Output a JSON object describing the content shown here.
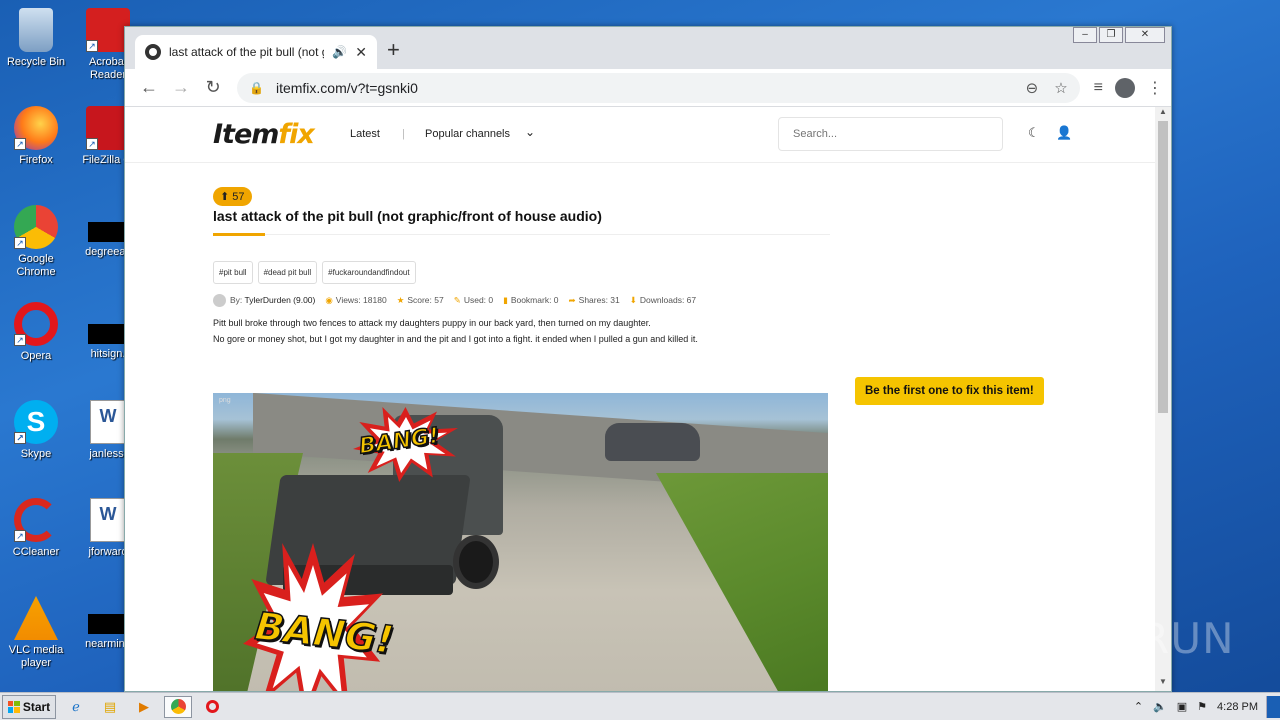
{
  "desktop": {
    "icons": [
      {
        "label": "Recycle Bin",
        "icon": "recycle-bin-icon",
        "color": "#9ab8d8"
      },
      {
        "label": "Acrobat Reader",
        "icon": "acrobat-icon",
        "color": "#d41f1f"
      },
      {
        "label": "Firefox",
        "icon": "firefox-icon",
        "color": "#ff7a18"
      },
      {
        "label": "FileZilla Cl",
        "icon": "filezilla-icon",
        "color": "#c7161d"
      },
      {
        "label": "Google Chrome",
        "icon": "chrome-icon",
        "color": "#34a853"
      },
      {
        "label": "degreeac",
        "icon": "file-icon",
        "color": "#000000"
      },
      {
        "label": "Opera",
        "icon": "opera-icon",
        "color": "#e2171c"
      },
      {
        "label": "hitsign.",
        "icon": "file-icon",
        "color": "#000000"
      },
      {
        "label": "Skype",
        "icon": "skype-icon",
        "color": "#00aff0"
      },
      {
        "label": "janless.",
        "icon": "word-icon",
        "color": "#2b5797"
      },
      {
        "label": "CCleaner",
        "icon": "ccleaner-icon",
        "color": "#d9281e"
      },
      {
        "label": "jforward",
        "icon": "word-icon",
        "color": "#2b5797"
      },
      {
        "label": "VLC media player",
        "icon": "vlc-icon",
        "color": "#f28c00"
      },
      {
        "label": "nearminu",
        "icon": "file-icon",
        "color": "#000000"
      }
    ]
  },
  "browser": {
    "tab_title": "last attack of the pit bull (not gr",
    "new_tab": "+",
    "url": "itemfix.com/v?t=gsnki0"
  },
  "site": {
    "logo_main": "Item",
    "logo_accent": "fix",
    "nav_latest": "Latest",
    "nav_sep": "|",
    "nav_popular": "Popular channels",
    "search_placeholder": "Search..."
  },
  "item": {
    "score_badge": "57",
    "title": "last attack of the pit bull (not graphic/front of house audio)",
    "tags": [
      "#pit bull",
      "#dead pit bull",
      "#fuckaroundandfindout"
    ],
    "meta": {
      "by_label": "By:",
      "author": "TylerDurden (9.00)",
      "views": "Views: 18180",
      "score": "Score: 57",
      "used": "Used: 0",
      "bookmark": "Bookmark: 0",
      "shares": "Shares: 31",
      "downloads": "Downloads: 67"
    },
    "description_line1": "Pitt bull broke through two fences to attack my daughters puppy in our back yard, then turned on my daughter.",
    "description_line2": "No gore or money shot, but I got my daughter in and the pit and I got into a fight. it ended when I pulled a gun and killed it.",
    "media_label": "png",
    "bang_text_1": "BANG!",
    "bang_text_2": "BANG!",
    "cta": "Be the first one to fix this item!"
  },
  "taskbar": {
    "start": "Start",
    "time": "4:28 PM"
  },
  "watermark": "ANY RUN",
  "colors": {
    "accent": "#f0a500",
    "cta": "#f5c400"
  }
}
